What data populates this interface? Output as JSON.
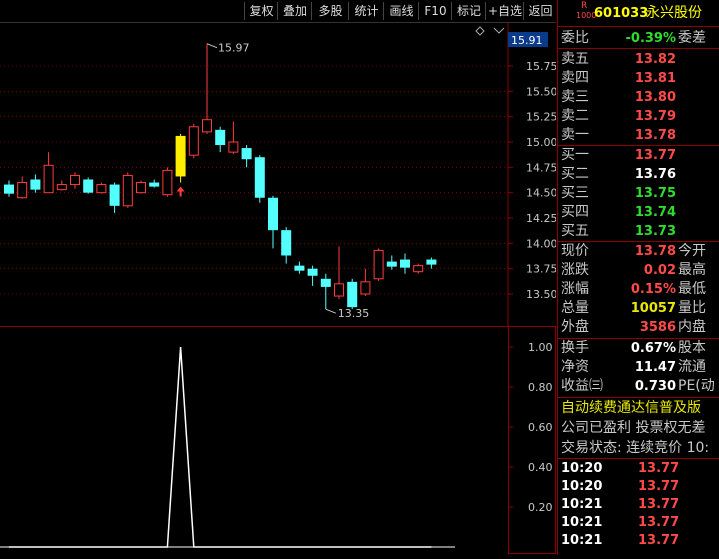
{
  "toolbar": {
    "buttons": [
      "复权",
      "叠加",
      "多股",
      "统计",
      "画线",
      "F10",
      "标记",
      "+自选",
      "返回"
    ]
  },
  "chart_data": [
    {
      "type": "candlestick",
      "high_label": "15.97",
      "low_label": "13.35",
      "current_price_label": "15.91",
      "y_ticks": [
        "15.75",
        "15.50",
        "15.25",
        "15.00",
        "14.75",
        "14.50",
        "14.25",
        "14.00",
        "13.75",
        "13.50"
      ],
      "candles": [
        {
          "o": 14.58,
          "c": 14.49,
          "h": 14.62,
          "l": 14.46
        },
        {
          "o": 14.45,
          "c": 14.6,
          "h": 14.66,
          "l": 14.44
        },
        {
          "o": 14.63,
          "c": 14.53,
          "h": 14.68,
          "l": 14.5
        },
        {
          "o": 14.5,
          "c": 14.77,
          "h": 14.9,
          "l": 14.5
        },
        {
          "o": 14.53,
          "c": 14.58,
          "h": 14.62,
          "l": 14.52
        },
        {
          "o": 14.58,
          "c": 14.67,
          "h": 14.7,
          "l": 14.54
        },
        {
          "o": 14.63,
          "c": 14.5,
          "h": 14.65,
          "l": 14.49
        },
        {
          "o": 14.5,
          "c": 14.58,
          "h": 14.6,
          "l": 14.49
        },
        {
          "o": 14.58,
          "c": 14.37,
          "h": 14.6,
          "l": 14.3
        },
        {
          "o": 14.37,
          "c": 14.67,
          "h": 14.7,
          "l": 14.35
        },
        {
          "o": 14.5,
          "c": 14.6,
          "h": 14.62,
          "l": 14.49
        },
        {
          "o": 14.6,
          "c": 14.56,
          "h": 14.63,
          "l": 14.55
        },
        {
          "o": 14.48,
          "c": 14.72,
          "h": 14.75,
          "l": 14.46
        },
        {
          "o": 14.66,
          "c": 15.06,
          "h": 15.08,
          "l": 14.6,
          "highlight": true
        },
        {
          "o": 14.87,
          "c": 15.15,
          "h": 15.18,
          "l": 14.84
        },
        {
          "o": 15.1,
          "c": 15.22,
          "h": 15.97,
          "l": 15.08
        },
        {
          "o": 15.12,
          "c": 14.97,
          "h": 15.15,
          "l": 14.9
        },
        {
          "o": 14.9,
          "c": 15.0,
          "h": 15.2,
          "l": 14.88
        },
        {
          "o": 14.94,
          "c": 14.83,
          "h": 14.97,
          "l": 14.75
        },
        {
          "o": 14.85,
          "c": 14.45,
          "h": 14.87,
          "l": 14.4
        },
        {
          "o": 14.45,
          "c": 14.13,
          "h": 14.47,
          "l": 13.95
        },
        {
          "o": 14.13,
          "c": 13.88,
          "h": 14.16,
          "l": 13.8
        },
        {
          "o": 13.78,
          "c": 13.73,
          "h": 13.82,
          "l": 13.7
        },
        {
          "o": 13.75,
          "c": 13.68,
          "h": 13.78,
          "l": 13.58
        },
        {
          "o": 13.65,
          "c": 13.57,
          "h": 13.7,
          "l": 13.35
        },
        {
          "o": 13.48,
          "c": 13.6,
          "h": 13.97,
          "l": 13.45
        },
        {
          "o": 13.62,
          "c": 13.37,
          "h": 13.65,
          "l": 13.35
        },
        {
          "o": 13.5,
          "c": 13.62,
          "h": 13.75,
          "l": 13.48
        },
        {
          "o": 13.65,
          "c": 13.93,
          "h": 13.95,
          "l": 13.63
        },
        {
          "o": 13.82,
          "c": 13.77,
          "h": 13.88,
          "l": 13.74
        },
        {
          "o": 13.84,
          "c": 13.76,
          "h": 13.9,
          "l": 13.7
        },
        {
          "o": 13.72,
          "c": 13.78,
          "h": 13.8,
          "l": 13.7
        },
        {
          "o": 13.84,
          "c": 13.79,
          "h": 13.86,
          "l": 13.75
        }
      ]
    },
    {
      "type": "line",
      "y_ticks": [
        "1.00",
        "0.80",
        "0.60",
        "0.40",
        "0.20"
      ],
      "ylim": [
        0,
        1.0
      ],
      "values": [
        0,
        0,
        0,
        0,
        0,
        0,
        0,
        0,
        0,
        0,
        0,
        0,
        0,
        1,
        0,
        0,
        0,
        0,
        0,
        0,
        0,
        0,
        0,
        0,
        0,
        0,
        0,
        0,
        0,
        0,
        0,
        0,
        0
      ]
    }
  ],
  "quote": {
    "r_label": "R",
    "code_small": "1000",
    "code": "601033",
    "name": "永兴股份",
    "wb_label": "委比",
    "wb_value": "-0.39%",
    "wb_right": "委差",
    "sell": [
      {
        "label": "卖五",
        "price": "13.82"
      },
      {
        "label": "卖四",
        "price": "13.81"
      },
      {
        "label": "卖三",
        "price": "13.80"
      },
      {
        "label": "卖二",
        "price": "13.79"
      },
      {
        "label": "卖一",
        "price": "13.78"
      }
    ],
    "buy": [
      {
        "label": "买一",
        "price": "13.77"
      },
      {
        "label": "买二",
        "price": "13.76"
      },
      {
        "label": "买三",
        "price": "13.75"
      },
      {
        "label": "买四",
        "price": "13.74"
      },
      {
        "label": "买五",
        "price": "13.73"
      }
    ],
    "stats": [
      {
        "label": "现价",
        "value": "13.78",
        "right": "今开"
      },
      {
        "label": "涨跌",
        "value": "0.02",
        "right": "最高"
      },
      {
        "label": "涨幅",
        "value": "0.15%",
        "right": "最低"
      },
      {
        "label": "总量",
        "value": "10057",
        "right": "量比"
      },
      {
        "label": "外盘",
        "value": "3586",
        "right": "内盘"
      }
    ],
    "stats2": [
      {
        "label": "换手",
        "value": "0.67%",
        "right": "股本"
      },
      {
        "label": "净资",
        "value": "11.47",
        "right": "流通"
      },
      {
        "label": "收益㈢",
        "value": "0.730",
        "right": "PE(动"
      }
    ],
    "notice": "自动续费通达信普及版",
    "info1": "公司已盈利 投票权无差",
    "status": "交易状态: 连续竞价 10:",
    "ticks": [
      {
        "time": "10:20",
        "price": "13.77"
      },
      {
        "time": "10:20",
        "price": "13.77"
      },
      {
        "time": "10:21",
        "price": "13.77"
      },
      {
        "time": "10:21",
        "price": "13.77"
      },
      {
        "time": "10:21",
        "price": "13.77"
      }
    ]
  }
}
